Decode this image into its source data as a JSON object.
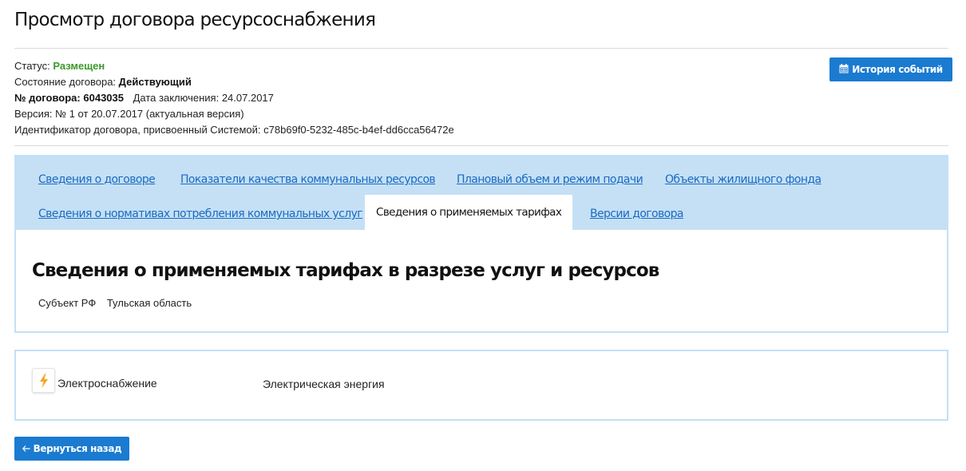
{
  "page": {
    "title": "Просмотр договора ресурсоснабжения"
  },
  "contract": {
    "status_label": "Статус:",
    "status_value": "Размещен",
    "state_label": "Состояние договора:",
    "state_value": "Действующий",
    "number_label": "№ договора:",
    "number_value": "6043035",
    "date_label": "Дата заключения:",
    "date_value": "24.07.2017",
    "version_text": "Версия: № 1 от 20.07.2017 (актуальная версия)",
    "id_label": "Идентификатор договора, присвоенный Системой:",
    "id_value": "c78b69f0-5232-485c-b4ef-dd6cca56472e"
  },
  "buttons": {
    "history_label": "История событий",
    "history_icon": "calendar-icon",
    "back_label": "Вернуться назад",
    "back_icon": "arrow-left-icon"
  },
  "tabs": [
    {
      "label": "Сведения о договоре",
      "active": false
    },
    {
      "label": "Показатели качества коммунальных ресурсов",
      "active": false
    },
    {
      "label": "Плановый объем и режим подачи",
      "active": false
    },
    {
      "label": "Объекты жилищного фонда",
      "active": false
    },
    {
      "label": "Сведения о нормативах потребления коммунальных услуг",
      "active": false
    },
    {
      "label": "Сведения о применяемых тарифах",
      "active": true
    },
    {
      "label": "Версии договора",
      "active": false
    }
  ],
  "section": {
    "title": "Сведения о применяемых тарифах в разрезе услуг и ресурсов",
    "subject_label": "Субъект РФ",
    "subject_value": "Тульская область"
  },
  "service": {
    "icon": "lightning-icon",
    "name": "Электроснабжение",
    "resource": "Электрическая энергия"
  },
  "colors": {
    "accent": "#1a7bd1",
    "status_green": "#3a9a2a",
    "tab_panel_bg": "#c5e0f5",
    "link": "#1a6bc2",
    "lightning": "#f5a623"
  }
}
